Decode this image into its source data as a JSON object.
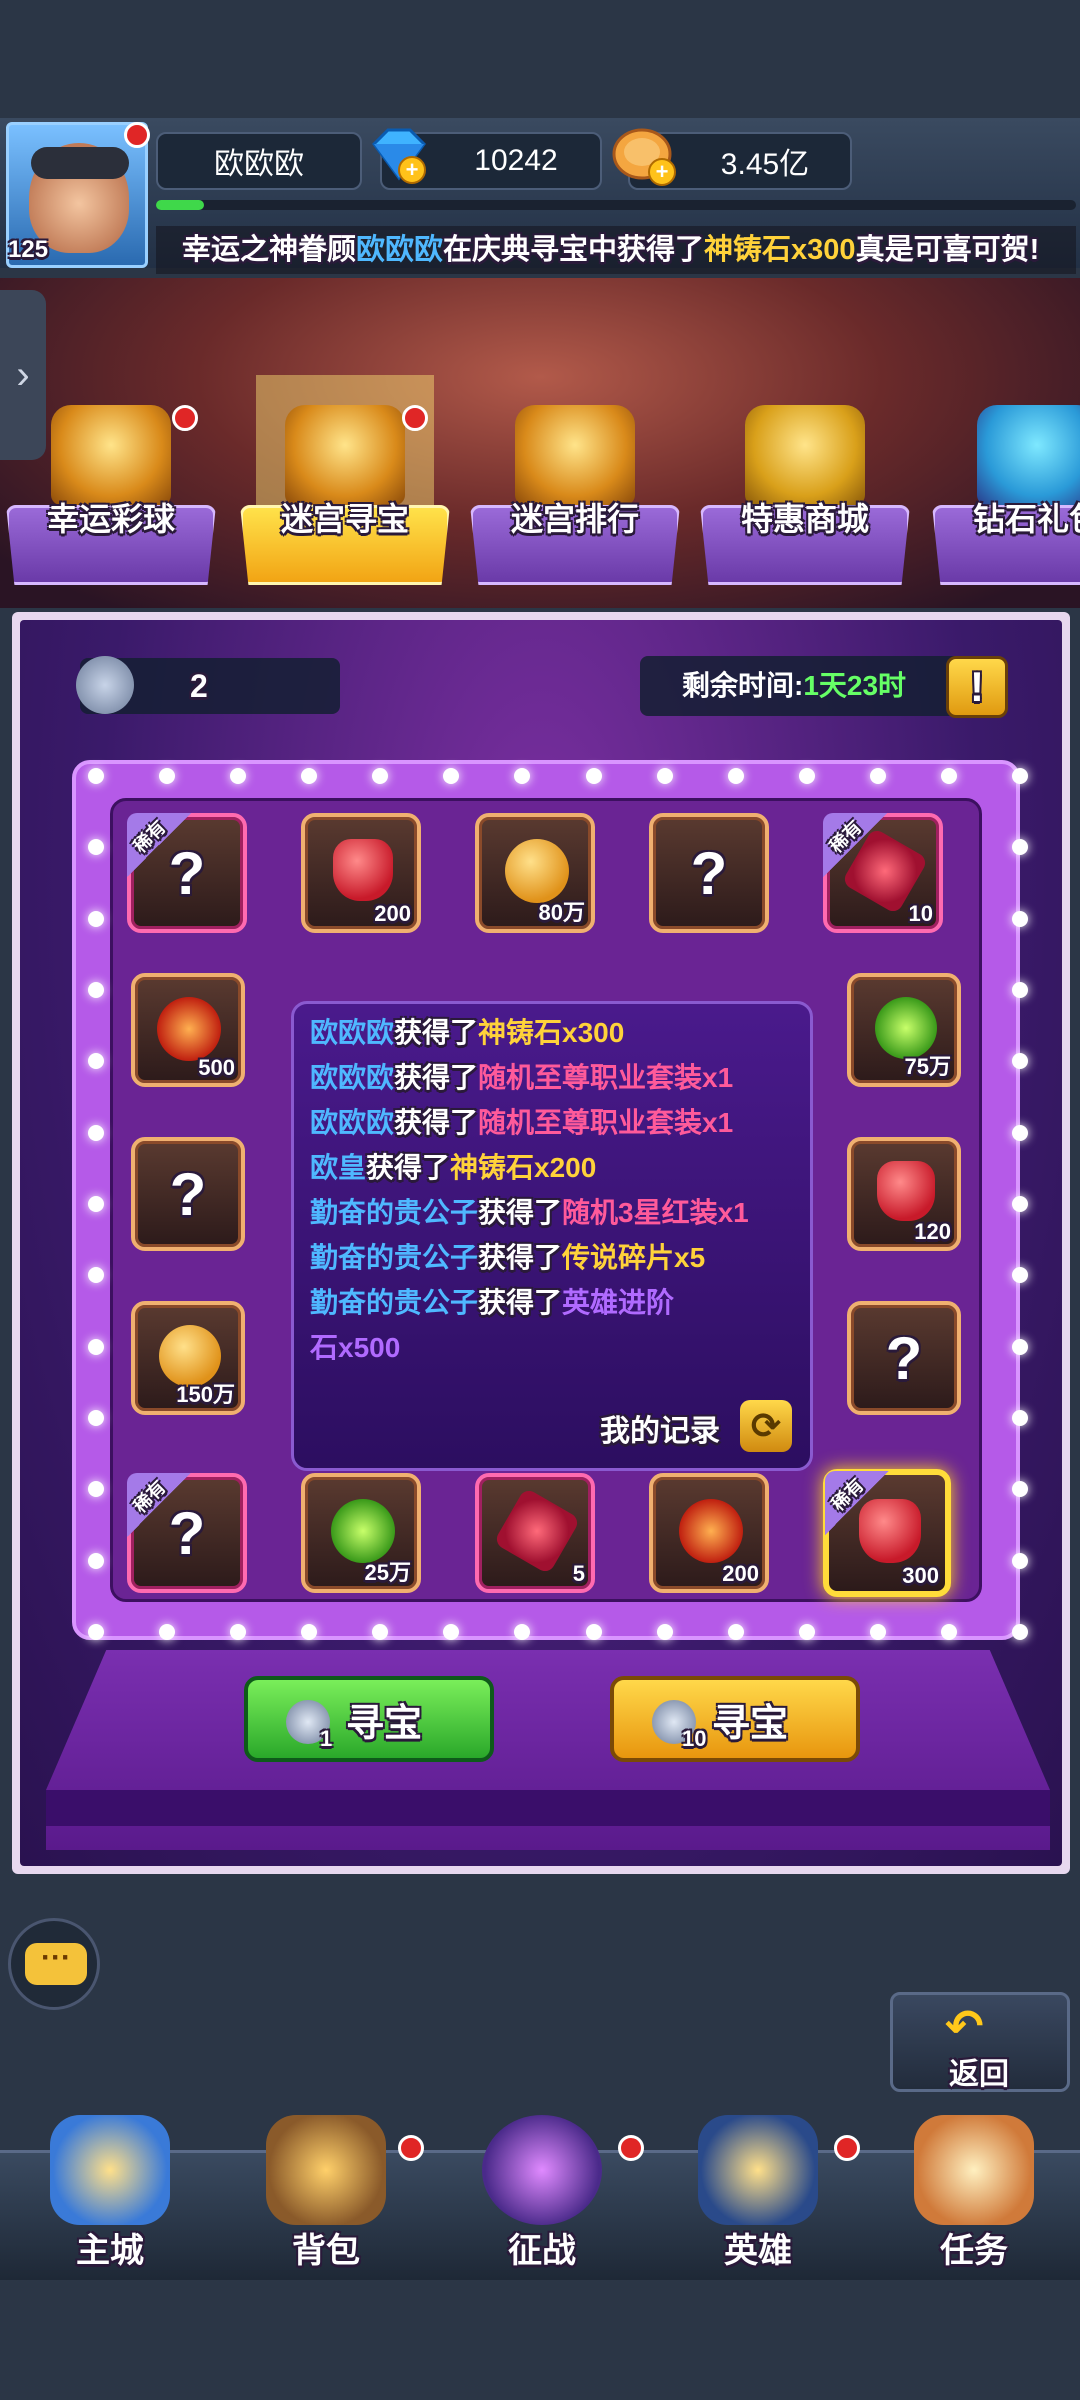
{
  "player": {
    "level": "125",
    "name": "欧欧欧",
    "gems": "10242",
    "gold": "3.45亿"
  },
  "broadcast": {
    "prefix": "幸运之神眷顾",
    "name": "欧欧欧",
    "mid": "在庆典寻宝中获得了",
    "item": "神铸石x300",
    "suffix": "真是可喜可贺!"
  },
  "tabs": [
    {
      "label": "幸运彩球"
    },
    {
      "label": "迷宫寻宝"
    },
    {
      "label": "迷宫排行"
    },
    {
      "label": "特惠商城"
    },
    {
      "label": "钻石礼包"
    }
  ],
  "panel": {
    "keys": "2",
    "time_label": "剩余时间:",
    "time_value": "1天23时",
    "alert": "!"
  },
  "rare_tag": "稀有",
  "grid": {
    "top": [
      "",
      "200",
      "80万",
      "",
      "10"
    ],
    "left": [
      "500",
      "",
      "150万"
    ],
    "right": [
      "75万",
      "120",
      ""
    ],
    "bottom": [
      "",
      "25万",
      "5",
      "200",
      "300"
    ]
  },
  "log": [
    {
      "who": "欧欧欧",
      "got": "获得了",
      "item": "神铸石x300"
    },
    {
      "who": "欧欧欧",
      "got": "获得了",
      "item": "随机至尊职业套装x1"
    },
    {
      "who": "欧欧欧",
      "got": "获得了",
      "item": "随机至尊职业套装x1"
    },
    {
      "who": "欧皇",
      "got": "获得了",
      "item": "神铸石x200"
    },
    {
      "who": "勤奋的贵公子",
      "got": "获得了",
      "item": "随机3星红装x1"
    },
    {
      "who": "勤奋的贵公子",
      "got": "获得了",
      "item": "传说碎片x5"
    },
    {
      "who": "勤奋的贵公子",
      "got": "获得了",
      "item": "英雄进阶"
    },
    {
      "who": "",
      "got": "",
      "item": "石x500"
    }
  ],
  "my_record": "我的记录",
  "buttons": {
    "once_count": "1",
    "once_label": "寻宝",
    "ten_count": "10",
    "ten_label": "寻宝"
  },
  "back": "返回",
  "nav": [
    {
      "label": "主城"
    },
    {
      "label": "背包"
    },
    {
      "label": "征战"
    },
    {
      "label": "英雄"
    },
    {
      "label": "任务"
    }
  ],
  "colors": {
    "blue_name": "#4fb8ff",
    "gold_item": "#ffd23a",
    "pink_item": "#ff5a9a",
    "green_time": "#66ff66"
  }
}
